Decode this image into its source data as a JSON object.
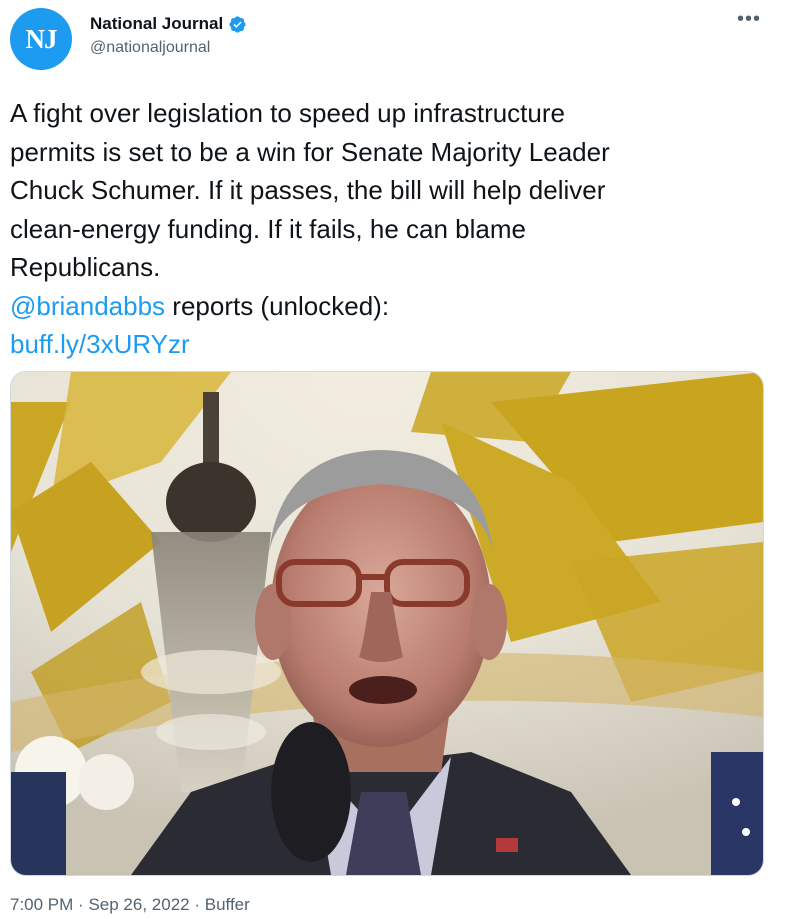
{
  "author": {
    "avatar_initials": "NJ",
    "display_name": "National Journal",
    "handle": "@nationaljournal",
    "verified": true,
    "avatar_color": "#1d9bf0"
  },
  "menu_icon": "more-horizontal-icon",
  "tweet": {
    "text_lines": [
      "A fight over legislation to speed up infrastructure",
      "permits is set to be a win for Senate Majority Leader",
      "Chuck Schumer. If it passes, the bill will help deliver",
      "clean-energy funding. If it fails, he can blame",
      "Republicans."
    ],
    "mention": "@briandabbs",
    "mention_suffix": " reports (unlocked):",
    "link": "buff.ly/3xURYzr"
  },
  "media": {
    "kind": "photo"
  },
  "meta": {
    "time": "7:00 PM",
    "separator": "·",
    "date": "Sep 26, 2022",
    "source": "Buffer"
  },
  "colors": {
    "accent": "#1d9bf0",
    "text": "#0f1419",
    "muted": "#536471"
  }
}
